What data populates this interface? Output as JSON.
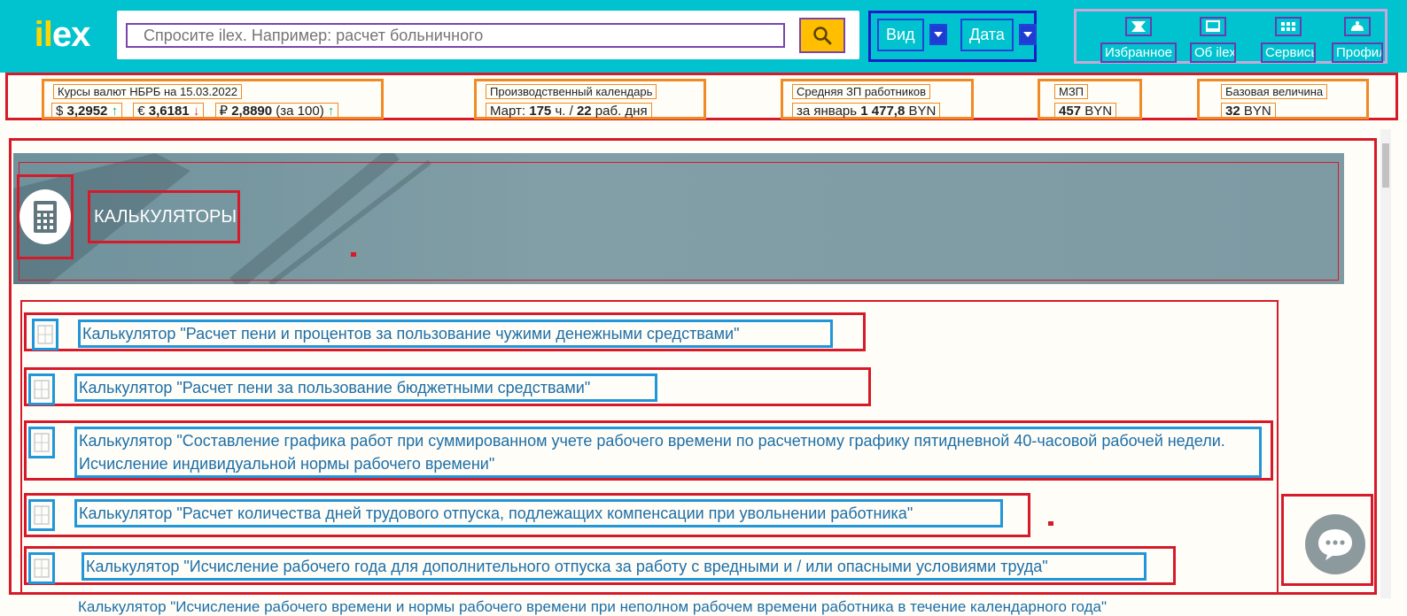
{
  "header": {
    "logo_main": "il",
    "logo_rest": "ex",
    "search_placeholder": "Спросите ilex. Например: расчет больничного",
    "filters": [
      {
        "label": "Вид"
      },
      {
        "label": "Дата"
      }
    ],
    "nav": [
      {
        "label": "Избранное",
        "icon": "star-icon"
      },
      {
        "label": "Об ilex",
        "icon": "book-icon"
      },
      {
        "label": "Сервисы",
        "icon": "grid-icon"
      },
      {
        "label": "Профиль",
        "icon": "profile-icon"
      }
    ]
  },
  "rates": {
    "currency": {
      "caption": "Курсы валют НБРБ на 15.03.2022",
      "usd_symbol": "$",
      "usd": "3,2952",
      "eur_symbol": "€",
      "eur": "3,6181",
      "rub_symbol": "₽",
      "rub": "2,8890",
      "rub_note": "(за 100)"
    },
    "calendar": {
      "caption": "Производственный календарь",
      "prefix": "Март:",
      "hours": "175",
      "hours_unit": "ч. /",
      "days": "22",
      "days_unit": "раб. дня"
    },
    "salary": {
      "caption": "Средняя ЗП работников",
      "prefix": "за январь",
      "value": "1 477,8",
      "unit": "BYN"
    },
    "mzp": {
      "caption": "МЗП",
      "value": "457",
      "unit": "BYN"
    },
    "base": {
      "caption": "Базовая величина",
      "value": "32",
      "unit": "BYN"
    }
  },
  "section": {
    "title": "КАЛЬКУЛЯТОРЫ"
  },
  "calculators": [
    {
      "label": "Калькулятор \"Расчет пени и процентов за пользование чужими денежными средствами\""
    },
    {
      "label": "Калькулятор \"Расчет пени за пользование бюджетными средствами\""
    },
    {
      "label": "Калькулятор \"Составление графика работ при суммированном учете рабочего времени по расчетному графику пятидневной 40-часовой рабочей недели. Исчисление индивидуальной нормы рабочего времени\""
    },
    {
      "label": "Калькулятор \"Расчет количества дней трудового отпуска, подлежащих компенсации при увольнении работника\""
    },
    {
      "label": "Калькулятор \"Исчисление рабочего года для дополнительного отпуска за работу с вредными и / или опасными условиями труда\""
    }
  ],
  "partial_next_item": "Калькулятор \"Исчисление рабочего времени и нормы рабочего времени при неполном рабочем времени работника в течение календарного года\"",
  "colors": {
    "header_bg": "#00c3cf",
    "search_btn": "#ffbe00",
    "link": "#1c6fa8",
    "banner": "#7e9aa3"
  }
}
